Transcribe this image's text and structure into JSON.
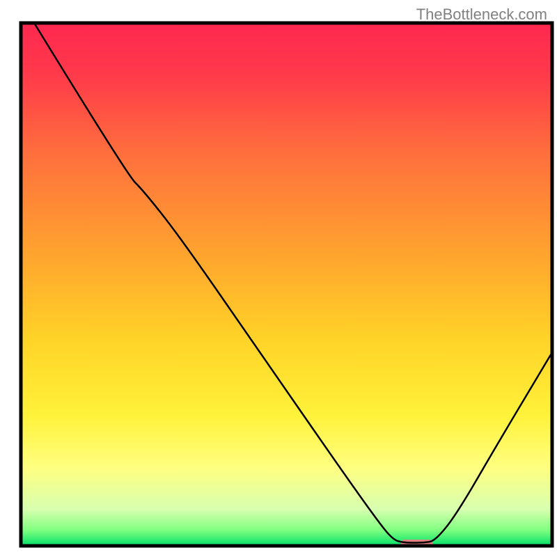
{
  "watermark": "TheBottleneck.com",
  "chart_data": {
    "type": "line",
    "title": "",
    "xlabel": "",
    "ylabel": "",
    "xlim": [
      0,
      100
    ],
    "ylim": [
      0,
      100
    ],
    "background": {
      "type": "vertical_gradient",
      "stops": [
        {
          "offset": 0.0,
          "color": "#ff2850"
        },
        {
          "offset": 0.1,
          "color": "#ff3a4a"
        },
        {
          "offset": 0.25,
          "color": "#ff6f3d"
        },
        {
          "offset": 0.45,
          "color": "#ffa62e"
        },
        {
          "offset": 0.6,
          "color": "#ffd227"
        },
        {
          "offset": 0.75,
          "color": "#fff23a"
        },
        {
          "offset": 0.85,
          "color": "#ffff80"
        },
        {
          "offset": 0.93,
          "color": "#d8ffb0"
        },
        {
          "offset": 0.97,
          "color": "#80ff80"
        },
        {
          "offset": 1.0,
          "color": "#00e068"
        }
      ]
    },
    "series": [
      {
        "name": "bottleneck-curve",
        "color": "#000000",
        "stroke_width": 2.5,
        "points": [
          {
            "x": 2.5,
            "y": 100
          },
          {
            "x": 20,
            "y": 71
          },
          {
            "x": 23,
            "y": 68
          },
          {
            "x": 30,
            "y": 59
          },
          {
            "x": 45,
            "y": 37
          },
          {
            "x": 60,
            "y": 15
          },
          {
            "x": 67,
            "y": 5
          },
          {
            "x": 70,
            "y": 1.2
          },
          {
            "x": 72,
            "y": 0.6
          },
          {
            "x": 76,
            "y": 0.6
          },
          {
            "x": 78,
            "y": 1.0
          },
          {
            "x": 82,
            "y": 6
          },
          {
            "x": 90,
            "y": 20
          },
          {
            "x": 100,
            "y": 37
          }
        ]
      }
    ],
    "markers": [
      {
        "name": "optimum-marker",
        "shape": "rounded_rect",
        "color": "#e58080",
        "x_center": 74.5,
        "y_value": 0.5,
        "width_pct": 6.0,
        "height_pct": 1.4
      }
    ],
    "frame": {
      "color": "#000000",
      "stroke_width": 5
    }
  }
}
